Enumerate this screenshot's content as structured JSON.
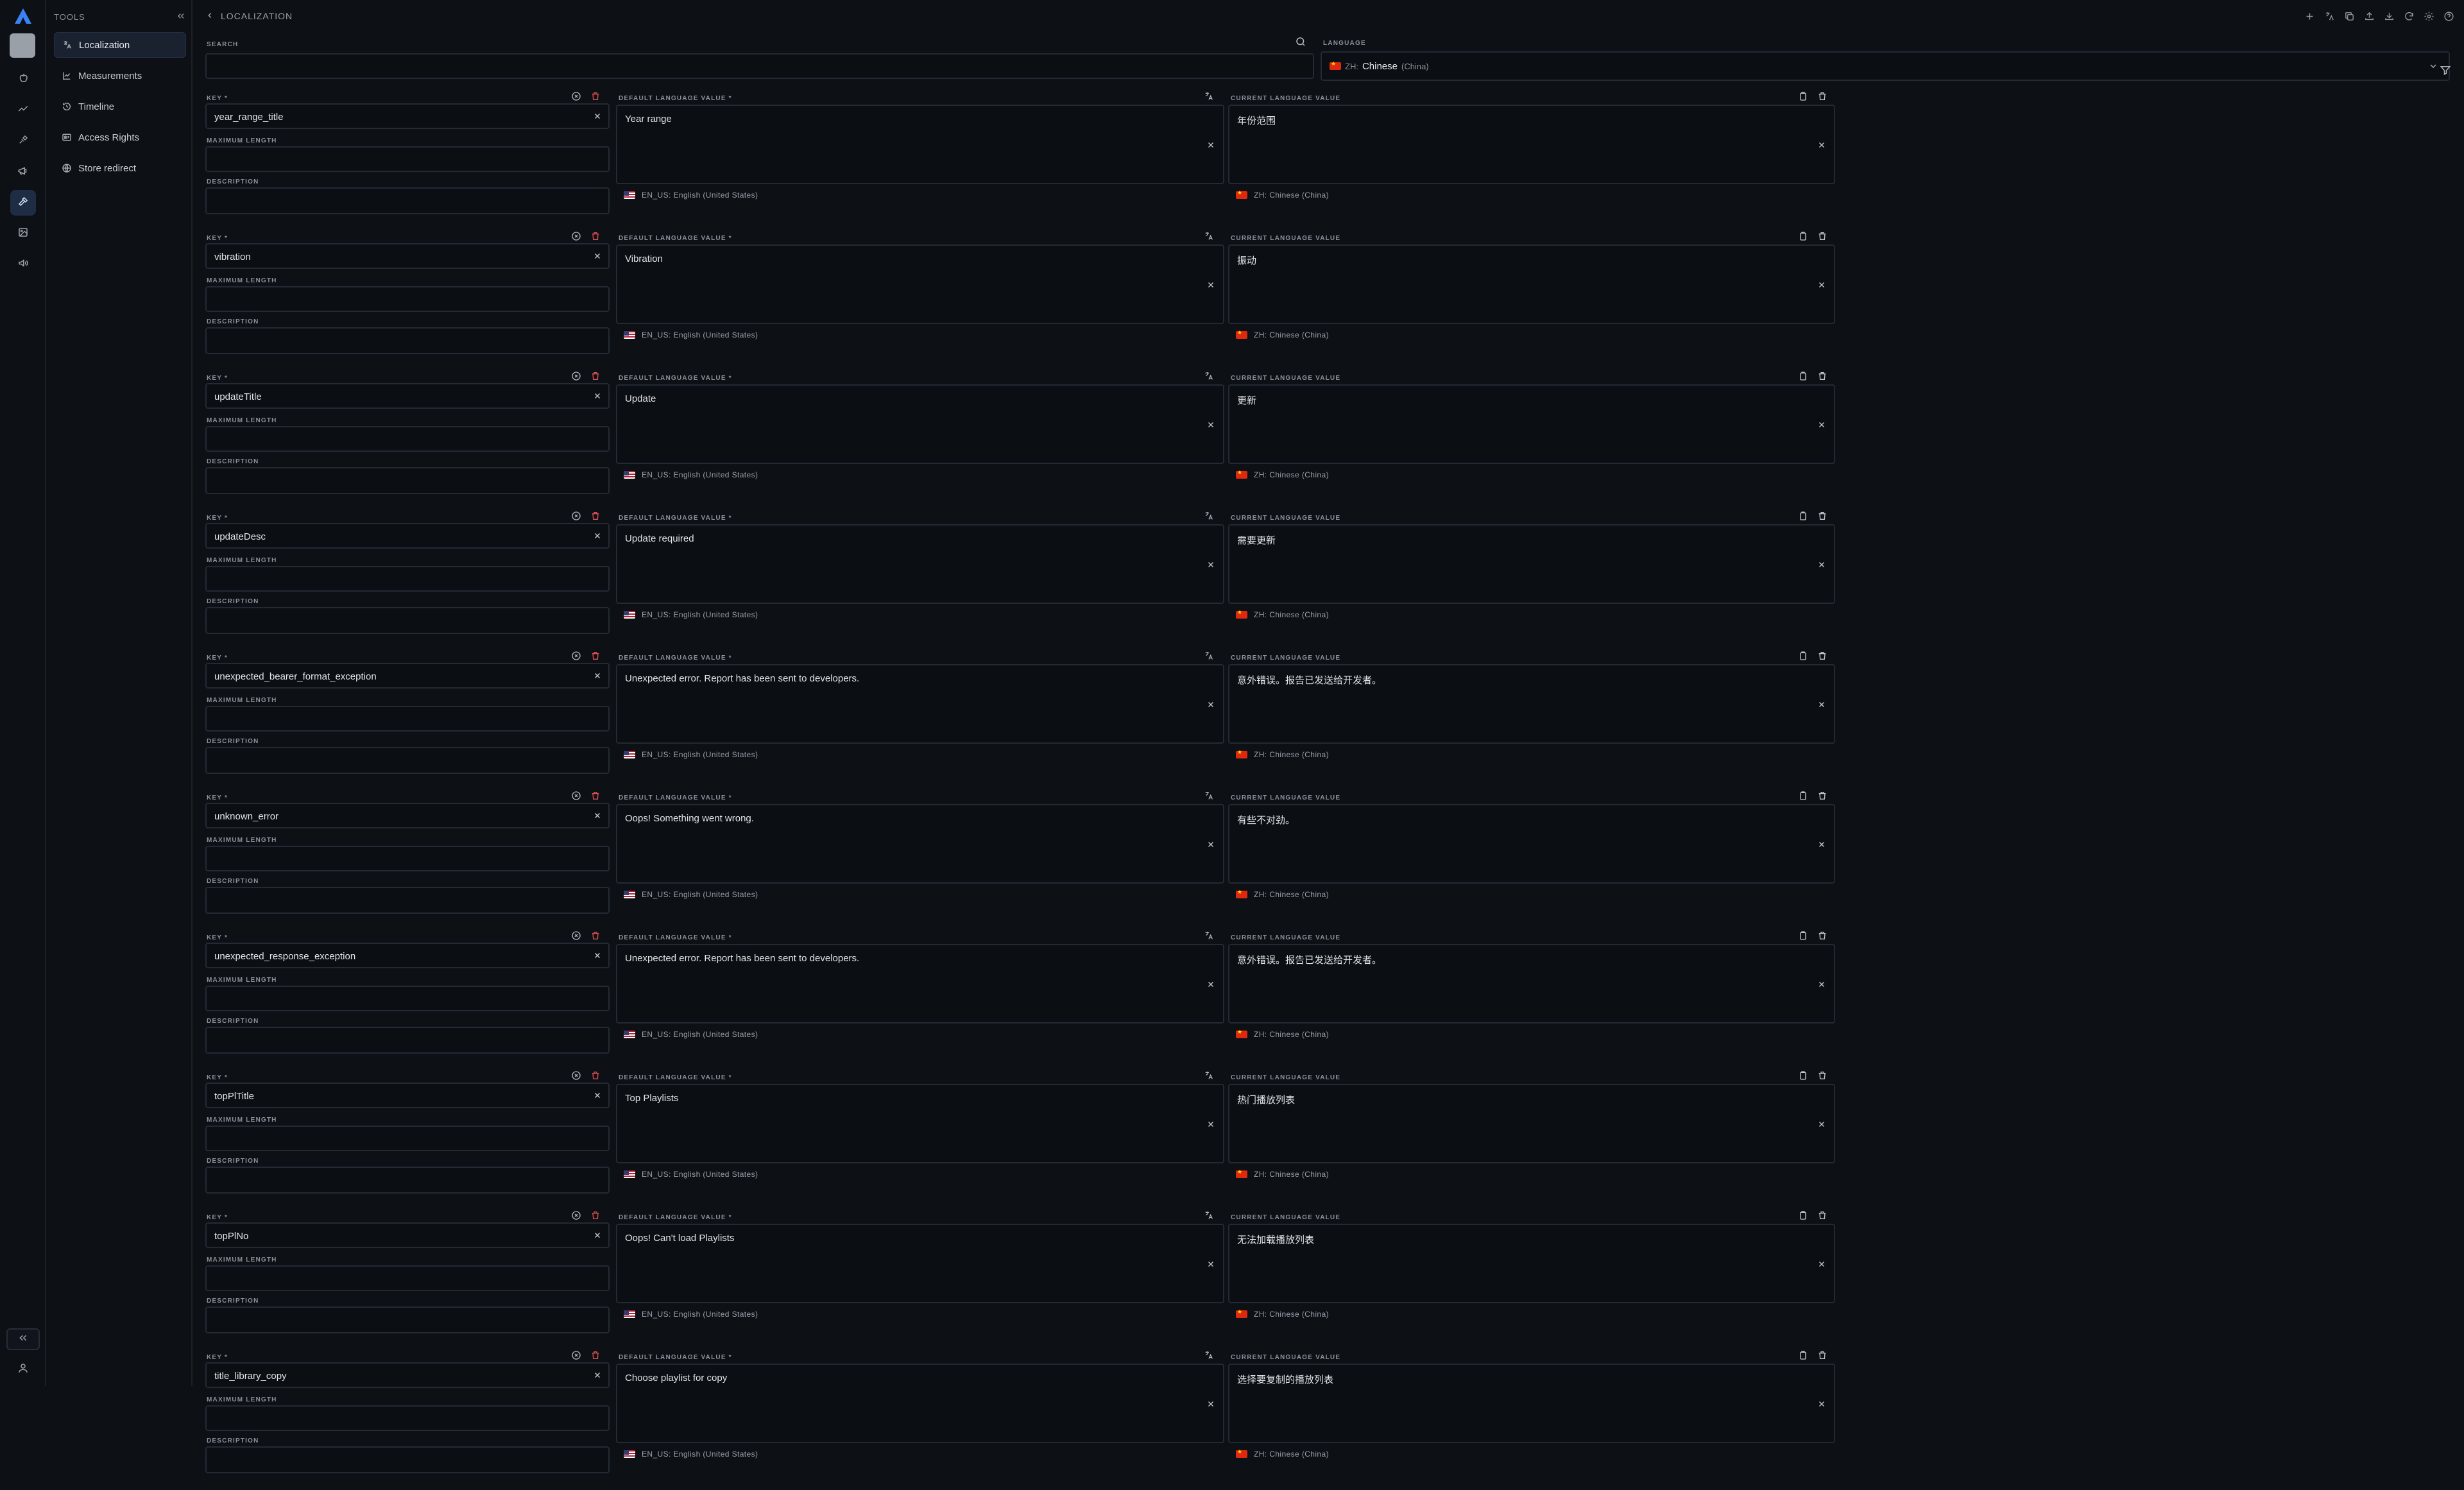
{
  "rail": {
    "collapse_label": "«",
    "colors": {
      "active_bg": "#1f2d44",
      "logo": "#3b82f6"
    }
  },
  "tools": {
    "title": "TOOLS",
    "items": [
      {
        "label": "Localization",
        "icon": "translate-icon",
        "active": true
      },
      {
        "label": "Measurements",
        "icon": "line-chart-icon",
        "active": false
      },
      {
        "label": "Timeline",
        "icon": "history-icon",
        "active": false
      },
      {
        "label": "Access Rights",
        "icon": "id-card-icon",
        "active": false
      },
      {
        "label": "Store redirect",
        "icon": "globe-icon",
        "active": false
      }
    ]
  },
  "breadcrumb": {
    "label": "LOCALIZATION"
  },
  "search": {
    "label": "SEARCH",
    "value": "",
    "placeholder": ""
  },
  "language": {
    "label": "LANGUAGE",
    "code": "ZH:",
    "name": "Chinese",
    "region": "(China)"
  },
  "labels": {
    "key": "KEY *",
    "max_length": "MAXIMUM LENGTH",
    "description": "DESCRIPTION",
    "default_value": "DEFAULT LANGUAGE VALUE *",
    "current_value": "CURRENT LANGUAGE VALUE",
    "default_lang": "EN_US: English (United States)",
    "current_lang": "ZH: Chinese (China)"
  },
  "entries": [
    {
      "key": "year_range_title",
      "default": "Year range",
      "current": "年份范围",
      "max_length": "",
      "description": ""
    },
    {
      "key": "vibration",
      "default": "Vibration",
      "current": "振动",
      "max_length": "",
      "description": ""
    },
    {
      "key": "updateTitle",
      "default": "Update",
      "current": "更新",
      "max_length": "",
      "description": ""
    },
    {
      "key": "updateDesc",
      "default": "Update required",
      "current": "需要更新",
      "max_length": "",
      "description": ""
    },
    {
      "key": "unexpected_bearer_format_exception",
      "default": "Unexpected error. Report has been sent to developers.",
      "current": "意外错误。报告已发送给开发者。",
      "max_length": "",
      "description": ""
    },
    {
      "key": "unknown_error",
      "default": "Oops! Something went wrong.",
      "current": "有些不对劲。",
      "max_length": "",
      "description": ""
    },
    {
      "key": "unexpected_response_exception",
      "default": "Unexpected error. Report has been sent to developers.",
      "current": "意外错误。报告已发送给开发者。",
      "max_length": "",
      "description": ""
    },
    {
      "key": "topPlTitle",
      "default": "Top Playlists",
      "current": "热门播放列表",
      "max_length": "",
      "description": ""
    },
    {
      "key": "topPlNo",
      "default": "Oops! Can't load Playlists",
      "current": "无法加载播放列表",
      "max_length": "",
      "description": ""
    },
    {
      "key": "title_library_copy",
      "default": "Choose playlist for copy",
      "current": "选择要复制的播放列表",
      "max_length": "",
      "description": ""
    }
  ]
}
